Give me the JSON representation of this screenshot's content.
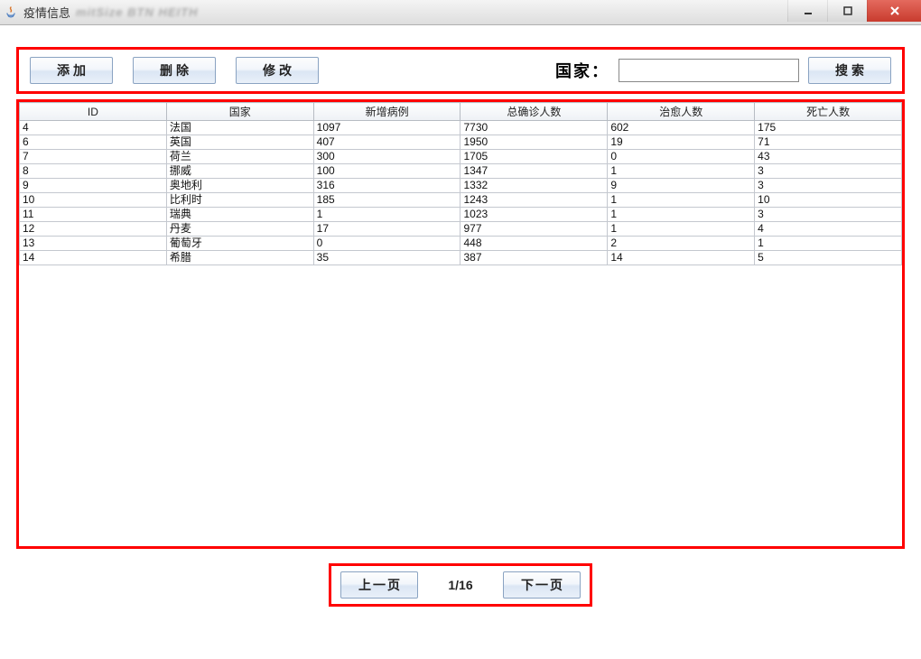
{
  "window": {
    "title": "疫情信息",
    "blurred_bg_text": "mitSize BTN HEITH"
  },
  "toolbar": {
    "add_label": "添加",
    "delete_label": "删除",
    "edit_label": "修改",
    "search_label": "国家：",
    "search_value": "",
    "search_button_label": "搜索"
  },
  "table": {
    "columns": [
      "ID",
      "国家",
      "新增病例",
      "总确诊人数",
      "治愈人数",
      "死亡人数"
    ],
    "rows": [
      [
        "4",
        "法国",
        "1097",
        "7730",
        "602",
        "175"
      ],
      [
        "6",
        "英国",
        "407",
        "1950",
        "19",
        "71"
      ],
      [
        "7",
        "荷兰",
        "300",
        "1705",
        "0",
        "43"
      ],
      [
        "8",
        "挪威",
        "100",
        "1347",
        "1",
        "3"
      ],
      [
        "9",
        "奥地利",
        "316",
        "1332",
        "9",
        "3"
      ],
      [
        "10",
        "比利时",
        "185",
        "1243",
        "1",
        "10"
      ],
      [
        "11",
        "瑞典",
        "1",
        "1023",
        "1",
        "3"
      ],
      [
        "12",
        "丹麦",
        "17",
        "977",
        "1",
        "4"
      ],
      [
        "13",
        "葡萄牙",
        "0",
        "448",
        "2",
        "1"
      ],
      [
        "14",
        "希腊",
        "35",
        "387",
        "14",
        "5"
      ]
    ]
  },
  "pager": {
    "prev_label": "上一页",
    "next_label": "下一页",
    "indicator": "1/16"
  }
}
